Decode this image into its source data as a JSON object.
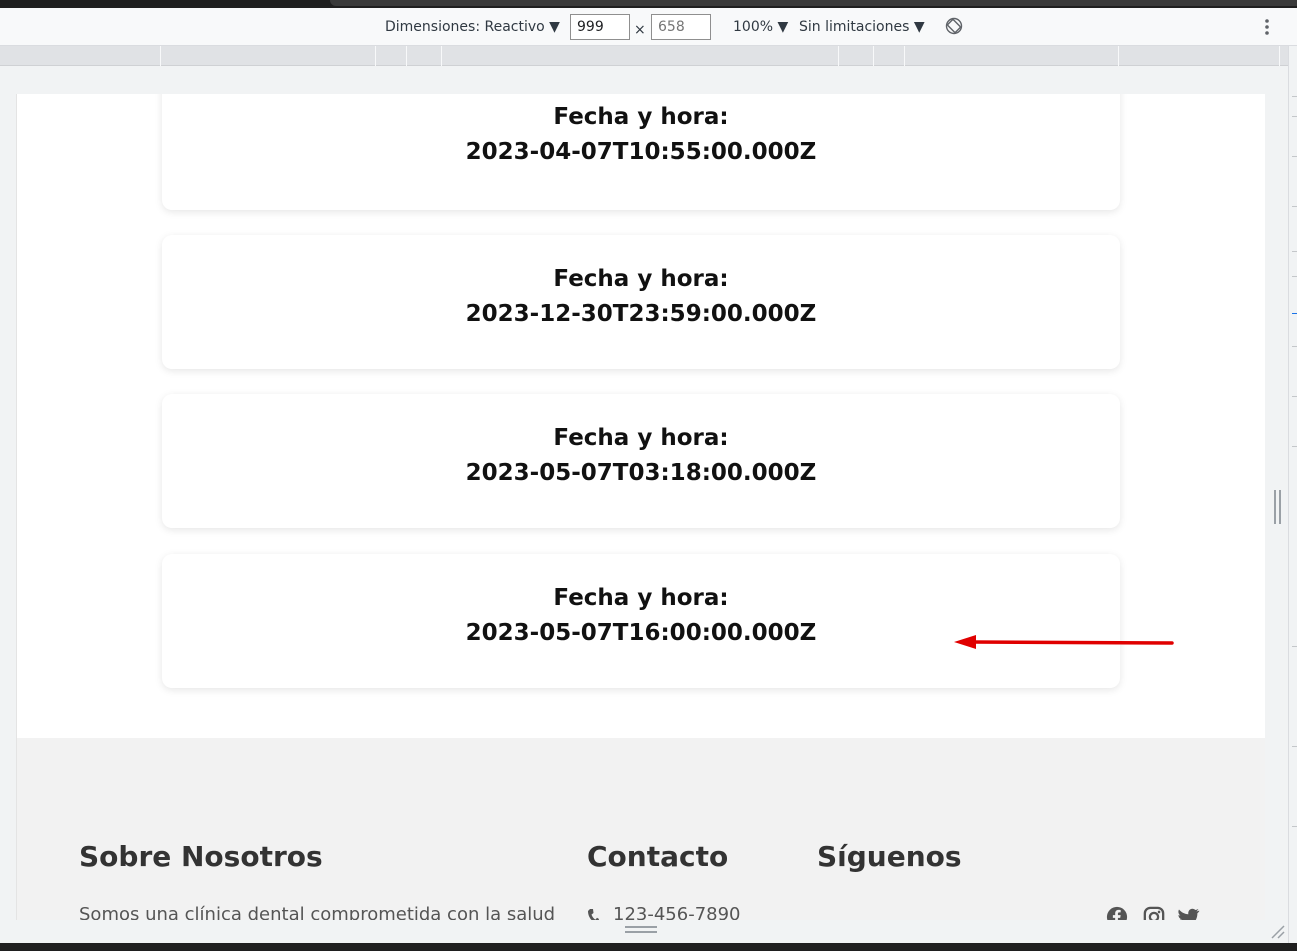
{
  "devtools": {
    "dimensions_label": "Dimensiones: Reactivo",
    "width_value": "999",
    "height_placeholder": "658",
    "times_symbol": "×",
    "zoom_label": "100%",
    "throttle_label": "Sin limitaciones",
    "dropdown_arrow": "▼",
    "rotate_icon": "rotate-icon",
    "more_icon": "more-vert-icon"
  },
  "appointments": [
    {
      "label": "Fecha y hora:",
      "value": "2023-04-07T10:55:00.000Z"
    },
    {
      "label": "Fecha y hora:",
      "value": "2023-12-30T23:59:00.000Z"
    },
    {
      "label": "Fecha y hora:",
      "value": "2023-05-07T03:18:00.000Z"
    },
    {
      "label": "Fecha y hora:",
      "value": "2023-05-07T16:00:00.000Z"
    }
  ],
  "footer": {
    "about": {
      "title": "Sobre Nosotros",
      "text": "Somos una clínica dental comprometida con la salud y"
    },
    "contact": {
      "title": "Contacto",
      "phone_icon": "phone-icon",
      "phone": "123-456-7890"
    },
    "follow": {
      "title": "Síguenos",
      "icons": [
        "facebook-icon",
        "instagram-icon",
        "twitter-icon"
      ]
    }
  },
  "colors": {
    "annotation_arrow": "#e00000",
    "page_background": "#ffffff",
    "footer_background": "#f2f2f2",
    "toolbar_background": "#f8f9fa"
  }
}
